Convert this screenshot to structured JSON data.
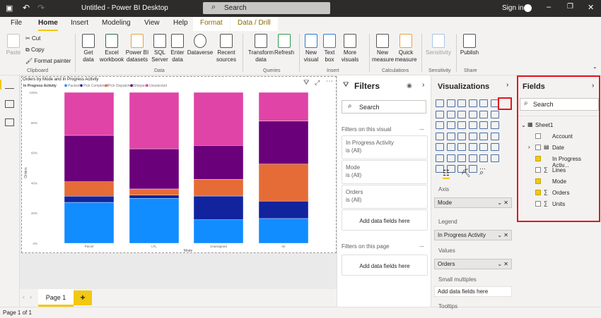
{
  "titlebar": {
    "title": "Untitled - Power BI Desktop",
    "search": "Search",
    "sign_in": "Sign in"
  },
  "menu_tabs": [
    "File",
    "Home",
    "Insert",
    "Modeling",
    "View",
    "Help",
    "Format",
    "Data / Drill"
  ],
  "ribbon": {
    "clipboard": {
      "paste": "Paste",
      "cut": "Cut",
      "copy": "Copy",
      "format_painter": "Format painter",
      "group": "Clipboard"
    },
    "data": {
      "items": [
        "Get data",
        "Excel workbook",
        "Power BI datasets",
        "SQL Server",
        "Enter data",
        "Dataverse",
        "Recent sources"
      ],
      "group": "Data"
    },
    "queries": {
      "items": [
        "Transform data",
        "Refresh"
      ],
      "group": "Queries"
    },
    "insert": {
      "items": [
        "New visual",
        "Text box",
        "More visuals"
      ],
      "group": "Insert"
    },
    "calculations": {
      "items": [
        "New measure",
        "Quick measure"
      ],
      "group": "Calculations"
    },
    "sensitivity": {
      "items": [
        "Sensitivity"
      ],
      "group": "Sensitivity"
    },
    "share": {
      "items": [
        "Publish"
      ],
      "group": "Share"
    }
  },
  "chart_data": {
    "type": "bar",
    "stacked": "100%",
    "title": "Orders by Mode and In Progress Activity",
    "legend_title": "In Progress Activity",
    "xlabel": "Mode",
    "ylabel": "Orders",
    "categories": [
      "Parcel",
      "LTL",
      "Unassigned",
      "Air"
    ],
    "yticks": [
      "0%",
      "20%",
      "40%",
      "60%",
      "80%",
      "100%"
    ],
    "ylim": [
      0,
      100
    ],
    "series": [
      {
        "name": "Packed",
        "color": "#118dff",
        "values": [
          27.1,
          29.8,
          15.6,
          16.4
        ]
      },
      {
        "name": "Pick Completed",
        "color": "#12239e",
        "values": [
          4.1,
          2.1,
          15.7,
          11.5
        ]
      },
      {
        "name": "Pick Dispatched",
        "color": "#e66c37",
        "values": [
          9.6,
          4.1,
          11.1,
          24.6
        ]
      },
      {
        "name": "Shipped",
        "color": "#6b007b",
        "values": [
          30.7,
          26.6,
          22.4,
          28.5
        ]
      },
      {
        "name": "Unselected",
        "color": "#e044a7",
        "values": [
          28.5,
          37.4,
          35.2,
          19.0
        ]
      }
    ]
  },
  "pages": {
    "tab": "Page 1",
    "add": "+",
    "status": "Page 1 of 1"
  },
  "filters": {
    "title": "Filters",
    "search": "Search",
    "on_visual": "Filters on this visual",
    "cards": [
      {
        "name": "In Progress Activity",
        "state": "is (All)"
      },
      {
        "name": "Mode",
        "state": "is (All)"
      },
      {
        "name": "Orders",
        "state": "is (All)"
      }
    ],
    "add": "Add data fields here",
    "on_page": "Filters on this page",
    "more": "..."
  },
  "visualizations": {
    "title": "Visualizations",
    "wells": {
      "axis_label": "Axis",
      "axis": "Mode",
      "legend_label": "Legend",
      "legend": "In Progress Activity",
      "values_label": "Values",
      "values": "Orders",
      "small_multiples_label": "Small multiples",
      "small_multiples": "Add data fields here",
      "tooltips_label": "Tooltips"
    }
  },
  "fields": {
    "title": "Fields",
    "search": "Search",
    "table": "Sheet1",
    "items": [
      {
        "name": "Account",
        "checked": false,
        "icon": ""
      },
      {
        "name": "Date",
        "checked": false,
        "icon": "calendar"
      },
      {
        "name": "In Progress Activ...",
        "checked": true,
        "icon": ""
      },
      {
        "name": "Lines",
        "checked": false,
        "icon": "sigma"
      },
      {
        "name": "Mode",
        "checked": true,
        "icon": ""
      },
      {
        "name": "Orders",
        "checked": true,
        "icon": "sigma"
      },
      {
        "name": "Units",
        "checked": false,
        "icon": "sigma"
      }
    ]
  }
}
